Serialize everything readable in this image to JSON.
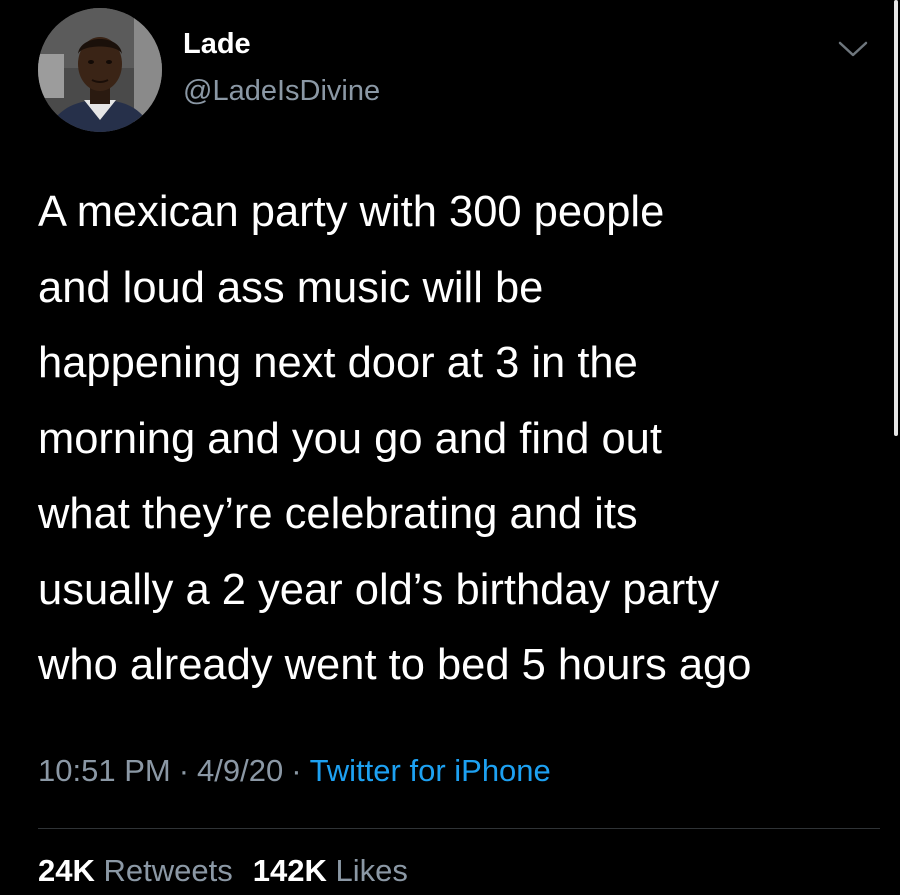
{
  "author": {
    "display_name": "Lade",
    "handle": "@LadeIsDivine"
  },
  "tweet": {
    "text_lines": [
      "A mexican party with 300 people",
      "and loud ass music will be",
      "happening next door at 3 in the",
      "morning and you go and find out",
      "what they’re celebrating and its",
      "usually a 2 year old’s birthday party",
      "who already went to bed 5 hours ago"
    ],
    "time": "10:51 PM",
    "date": "4/9/20",
    "separator": "·",
    "source": "Twitter for iPhone"
  },
  "stats": {
    "retweets_count": "24K",
    "retweets_label": "Retweets",
    "likes_count": "142K",
    "likes_label": "Likes"
  },
  "icons": {
    "menu": "chevron-down-icon",
    "avatar": "profile-photo"
  },
  "colors": {
    "background": "#000000",
    "primary_text": "#ffffff",
    "secondary_text": "#8b98a5",
    "link": "#1da1f2",
    "divider": "#2f3336"
  }
}
